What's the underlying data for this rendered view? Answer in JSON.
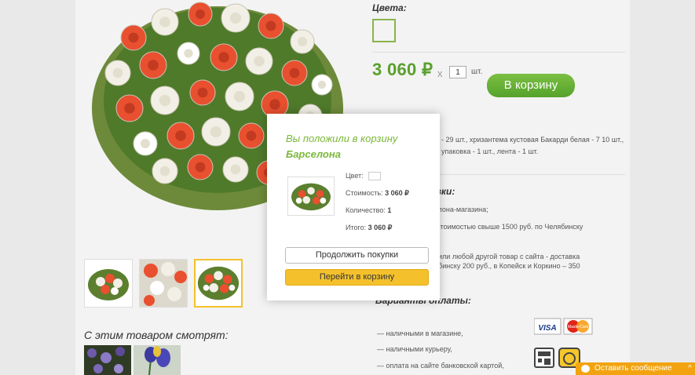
{
  "product": {
    "colors_label": "Цвета:",
    "price": "3 060 ₽",
    "times": "x",
    "qty": "1",
    "qty_unit": "шт.",
    "cart_button": "В корзину",
    "composition": "- 29 шт., хризантема кустовая Бакарди белая - 7 10 шт., упаковка - 1 шт., лента - 1 шт."
  },
  "delivery": {
    "title": "авки:",
    "lines": [
      "салона-магазина;",
      "стоимостью свыше 1500 руб. по Челябинску",
      "р. или любой другой товар с сайта - доставка",
      "лябинску 200 руб., в Копейск и Коркино – 350"
    ],
    "red_word": "в"
  },
  "payment": {
    "title": "Варианты оплаты:",
    "items": [
      "— наличными в магазине,",
      "— наличными курьеру,",
      "— оплата на сайте банковской картой,"
    ],
    "visa": "VISA",
    "mastercard": "MasterCard"
  },
  "also": {
    "title": "С этим товаром смотрят:"
  },
  "popup": {
    "title": "Вы положили в корзину",
    "product_name": "Барселона",
    "color_label": "Цвет:",
    "cost_label": "Стоимость:",
    "cost_value": "3 060 ₽",
    "qty_label": "Количество:",
    "qty_value": "1",
    "total_label": "Итого:",
    "total_value": "3 060 ₽",
    "continue_button": "Продолжить покупки",
    "goto_cart_button": "Перейти в корзину"
  },
  "chat": {
    "label": "Оставить сообщение",
    "arrow": "^"
  },
  "colors": {
    "accent_green": "#5aa02c",
    "button_yellow": "#f4c12d",
    "chat_orange": "#f2a30f"
  }
}
